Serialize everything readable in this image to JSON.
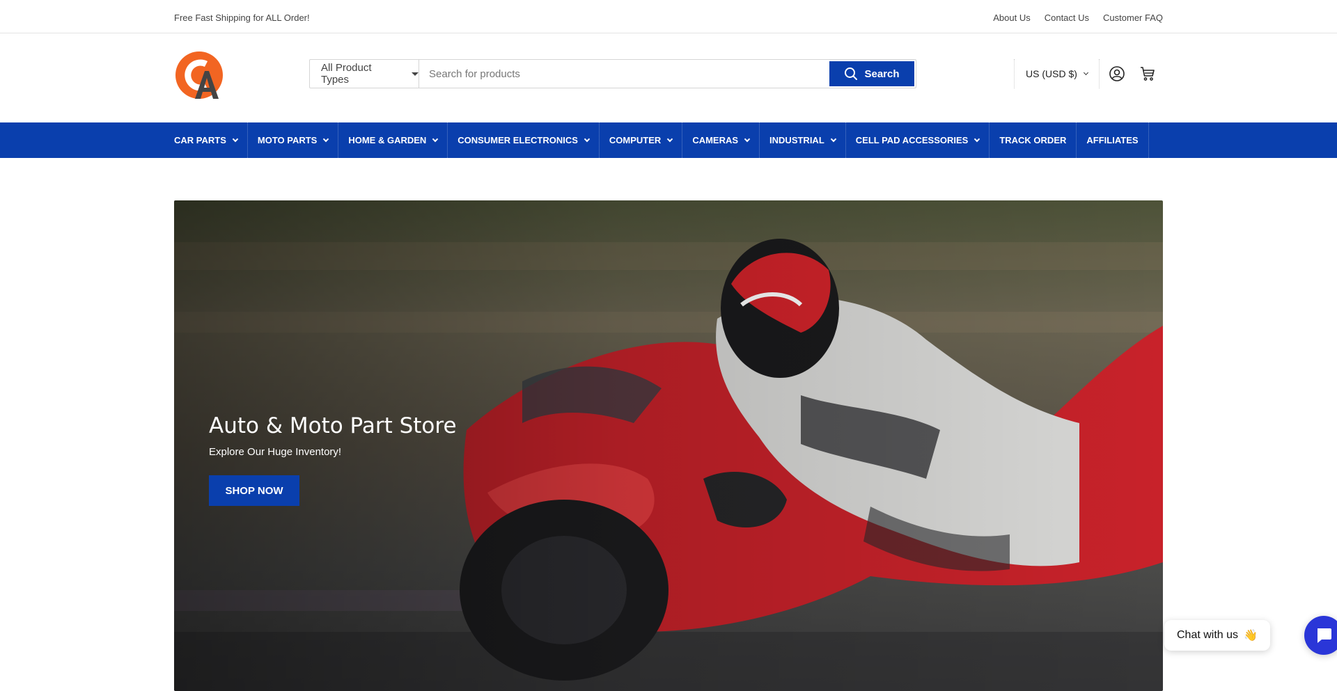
{
  "topbar": {
    "promo": "Free Fast Shipping for ALL Order!",
    "links": [
      "About Us",
      "Contact Us",
      "Customer FAQ"
    ]
  },
  "header": {
    "logo_letters": "CA",
    "product_type_select": "All Product Types",
    "search_placeholder": "Search for products",
    "search_button": "Search",
    "currency": "US (USD $)",
    "icons": [
      "account-icon",
      "cart-icon"
    ]
  },
  "nav": {
    "items": [
      {
        "label": "CAR PARTS",
        "dropdown": true
      },
      {
        "label": "MOTO PARTS",
        "dropdown": true
      },
      {
        "label": "HOME & GARDEN",
        "dropdown": true
      },
      {
        "label": "CONSUMER ELECTRONICS",
        "dropdown": true
      },
      {
        "label": "COMPUTER",
        "dropdown": true
      },
      {
        "label": "CAMERAS",
        "dropdown": true
      },
      {
        "label": "INDUSTRIAL",
        "dropdown": true
      },
      {
        "label": "CELL PAD ACCESSORIES",
        "dropdown": true
      },
      {
        "label": "TRACK ORDER",
        "dropdown": false
      },
      {
        "label": "AFFILIATES",
        "dropdown": false
      }
    ]
  },
  "hero": {
    "title": "Auto & Moto Part Store",
    "subtitle": "Explore Our Huge Inventory!",
    "button": "SHOP NOW"
  },
  "chat": {
    "label": "Chat with us",
    "emoji": "👋"
  },
  "colors": {
    "brand_blue": "#0a3fad",
    "logo_orange": "#f26522",
    "chat_blue": "#2a36d8"
  }
}
